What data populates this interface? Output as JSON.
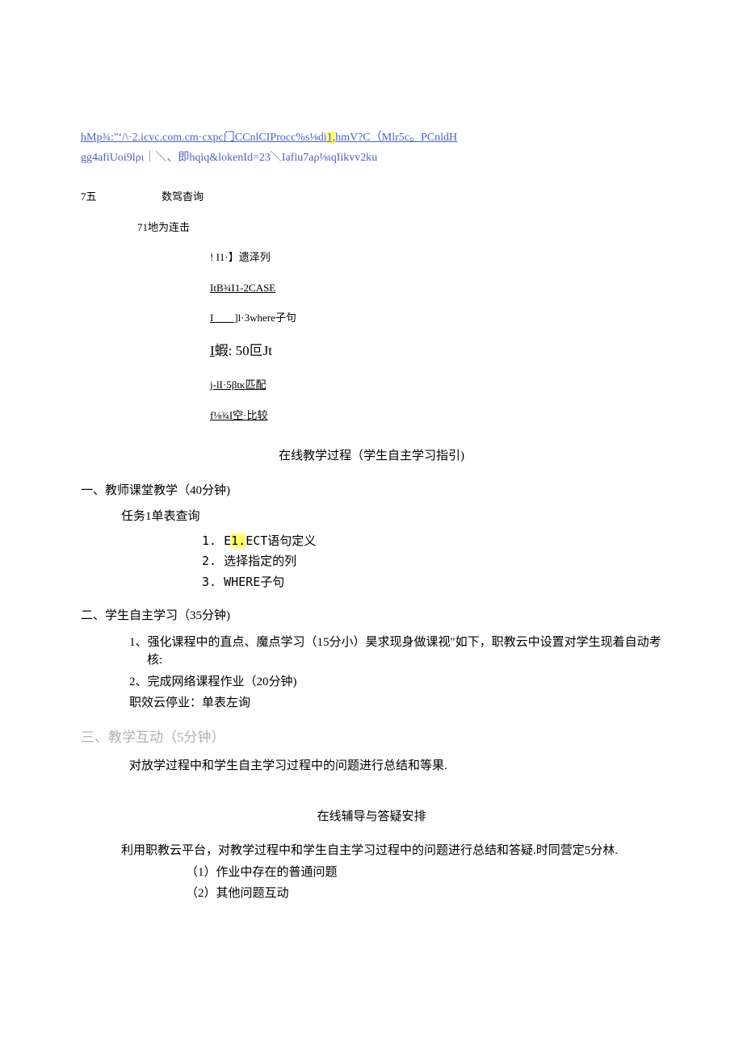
{
  "link": {
    "line1_pre": "hMp¾:\"ʻ/\\·2.icvc.com.cm·cxpc门CCnlCIProcc%s⅛di",
    "line1_hl": "1,",
    "line1_post": "hmV?C（Mlr5c。PCnldH",
    "line2": "gg4afiUoi9lρι｜＼、即hqiq&lokenId=23＼Iafiu7aρ⅛ιqIikvv2ku"
  },
  "sec7": {
    "num": "7五",
    "title": "数驾杳询",
    "sub": "71地为连击",
    "items": [
      {
        "pre": "!    ",
        "text": "I1·】遗泽列"
      },
      {
        "pre": "",
        "text": "ItB¾I1-2CASE",
        "u": true
      },
      {
        "pre": "",
        "text_u": "I____]",
        "text_rest": "l·3where子句"
      },
      {
        "pre": "",
        "big": true,
        "text_u": "I",
        "text_rest": "蝦: 50叵Jt"
      },
      {
        "pre": "",
        "text": "j-lI·5βtκ匹配",
        "u": true
      },
      {
        "pre": "",
        "text": "f⅛¾I空·比较",
        "u": true
      }
    ]
  },
  "process_heading": "在线教学过程（学生自主学习指引)",
  "section1": {
    "title": "一、教师课堂教学（40分钟)",
    "task": "任务1单表查询",
    "items": [
      {
        "num": "1.",
        "pre": "E",
        "hl": "1.",
        "post": "ECT语句定义"
      },
      {
        "num": "2.",
        "text": "选择指定的列"
      },
      {
        "num": "3.",
        "text": "WHERE子句"
      }
    ]
  },
  "section2": {
    "title": "二、学生自主学习（35分钟)",
    "item1": "1、强化课程中的直点、魔点学习（15分小）昊求现身做课视\"如下，职教云中设置对学生现着自动考核:",
    "item2": "2、完成网络课程作业（20分钟)",
    "item3": "职效云停业：单表左询"
  },
  "section3": {
    "title": "三、教学互动（5分钟）",
    "para": "对放学过程中和学生自主学习过程中的问题进行总结和等果."
  },
  "tutor_heading": "在线辅导与答疑安排",
  "tutor": {
    "intro": "利用职教云平台，对教学过程中和学生自主学习过程中的问题进行总结和答疑.时同营定5分林.",
    "p1": "（1）作业中存在的普通问题",
    "p2": "（2）其他问题互动"
  }
}
